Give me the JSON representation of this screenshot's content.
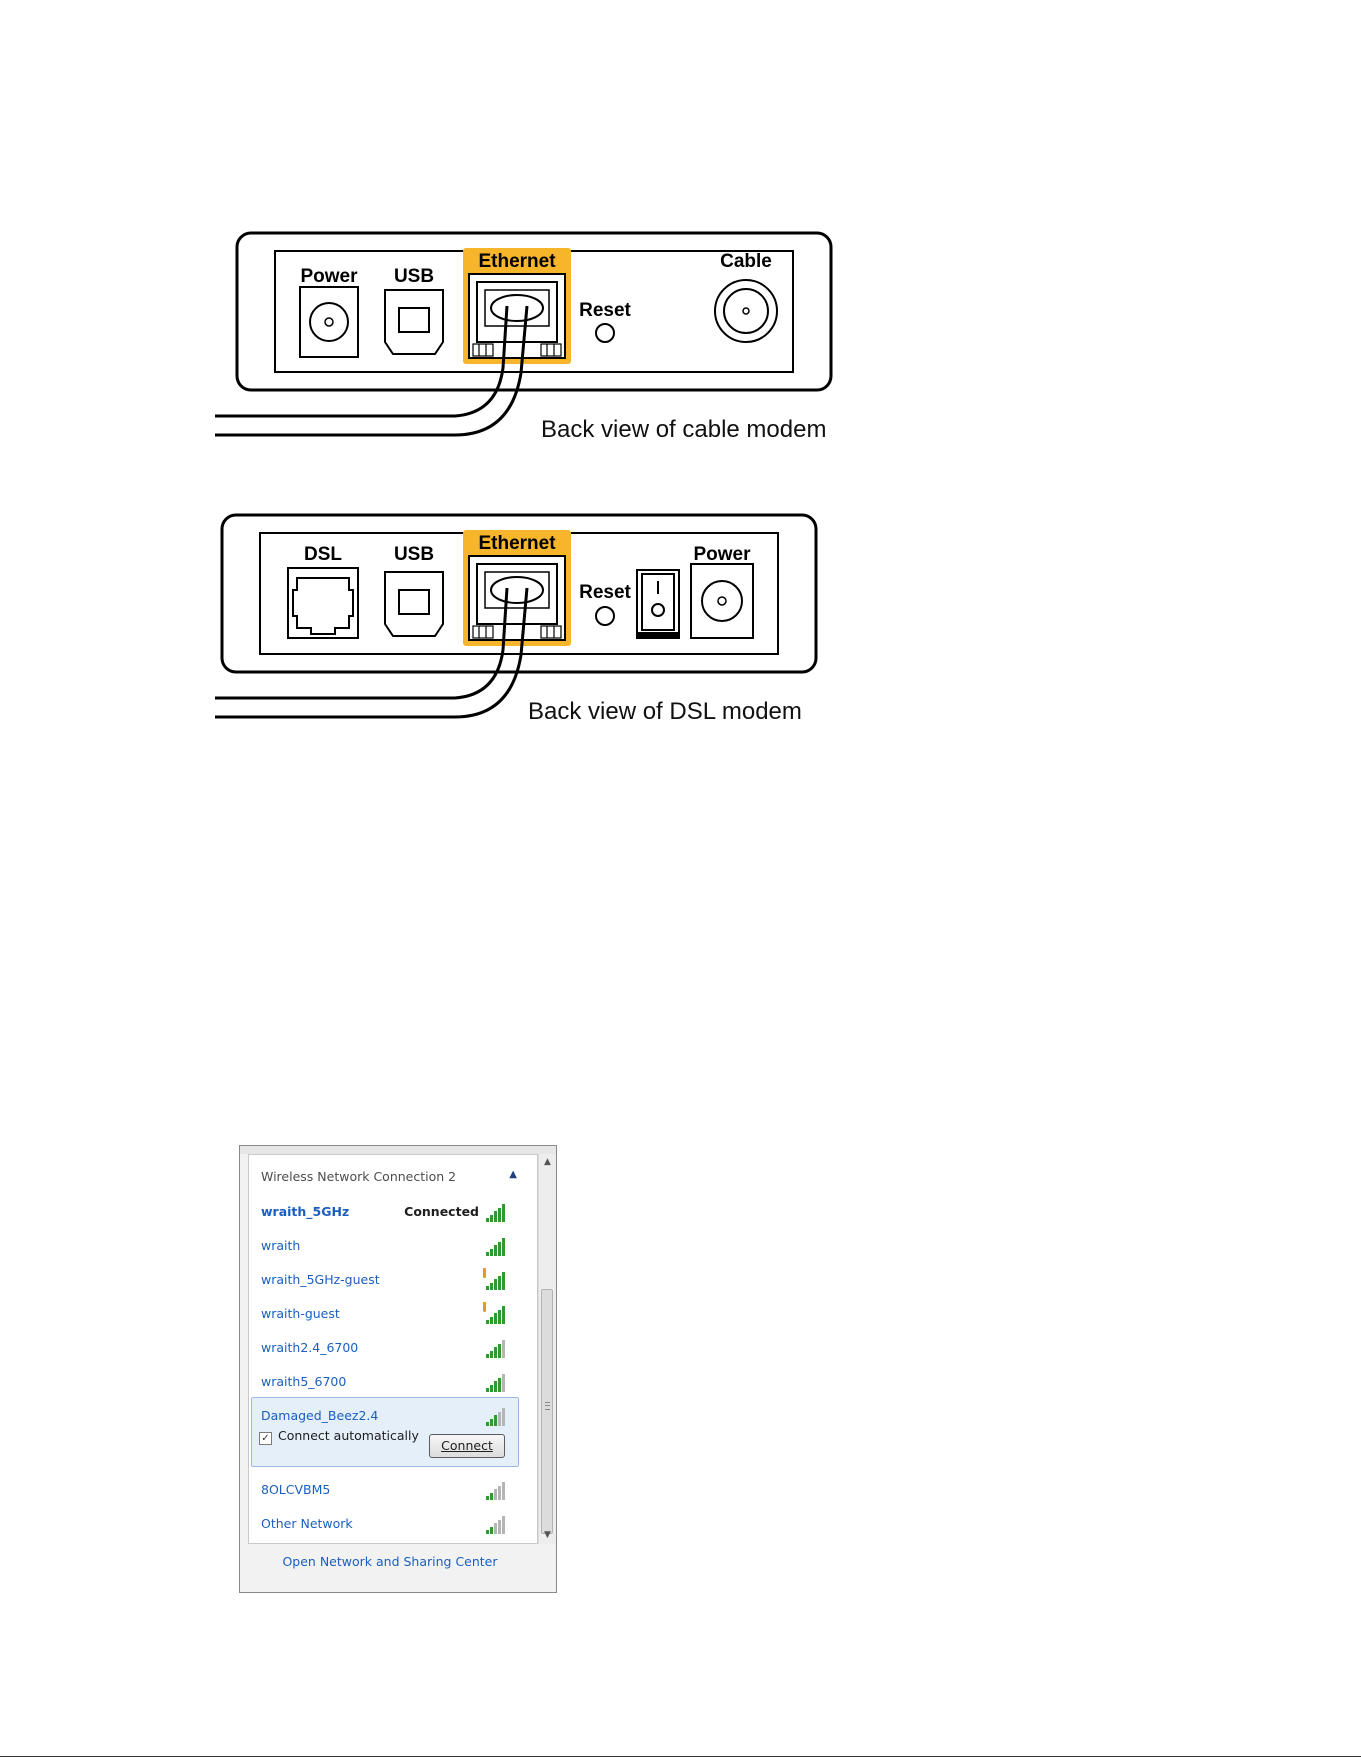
{
  "cable_figure": {
    "labels": {
      "power": "Power",
      "usb": "USB",
      "ethernet": "Ethernet",
      "reset": "Reset",
      "cable": "Cable"
    },
    "caption": "Back view of cable modem"
  },
  "dsl_figure": {
    "labels": {
      "dsl": "DSL",
      "usb": "USB",
      "ethernet": "Ethernet",
      "reset": "Reset",
      "power": "Power"
    },
    "caption": "Back view of DSL modem"
  },
  "wifi_flyout": {
    "group_title": "Wireless Network Connection 2",
    "networks": [
      {
        "name": "wraith_5GHz",
        "status": "Connected",
        "bars": 5,
        "secured_warning": false
      },
      {
        "name": "wraith",
        "status": "",
        "bars": 5,
        "secured_warning": false
      },
      {
        "name": "wraith_5GHz-guest",
        "status": "",
        "bars": 5,
        "secured_warning": true
      },
      {
        "name": "wraith-guest",
        "status": "",
        "bars": 5,
        "secured_warning": true
      },
      {
        "name": "wraith2.4_6700",
        "status": "",
        "bars": 4,
        "secured_warning": false
      },
      {
        "name": "wraith5_6700",
        "status": "",
        "bars": 4,
        "secured_warning": false
      },
      {
        "name": "Damaged_Beez2.4",
        "status": "",
        "bars": 3,
        "secured_warning": false
      },
      {
        "name": "8OLCVBM5",
        "status": "",
        "bars": 2,
        "secured_warning": false
      },
      {
        "name": "Other Network",
        "status": "",
        "bars": 2,
        "secured_warning": false
      }
    ],
    "selected": {
      "connect_automatically_label": "Connect automatically",
      "connect_automatically_checked": true,
      "connect_button": "Connect"
    },
    "footer_link": "Open Network and Sharing Center"
  },
  "colors": {
    "ethernet_highlight": "#f6b52b",
    "link_blue": "#1a5fc0",
    "signal_green": "#2f9a2f",
    "signal_gray": "#b5b5b5"
  }
}
